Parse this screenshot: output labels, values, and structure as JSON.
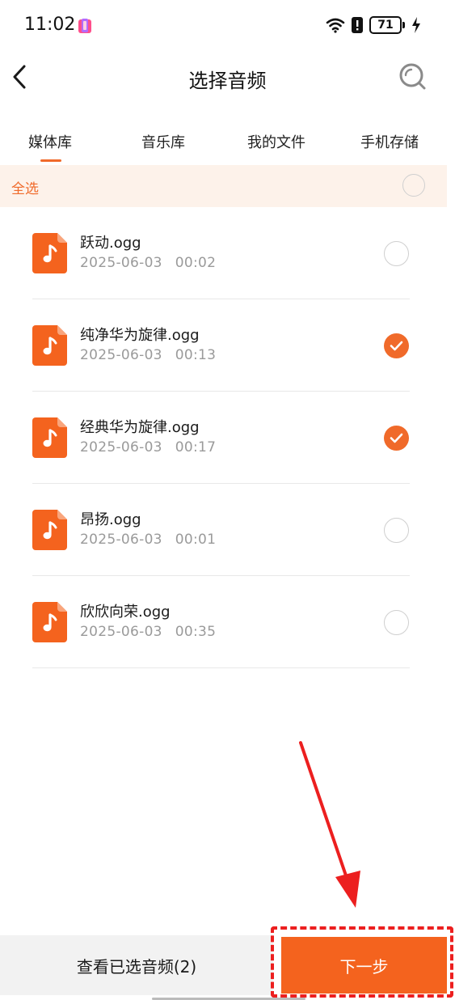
{
  "status_bar": {
    "time": "11:02",
    "battery": "71",
    "icons": [
      "app-badge-icon",
      "wifi-icon",
      "alert-icon",
      "battery-icon",
      "charging-icon"
    ]
  },
  "header": {
    "title": "选择音频",
    "back_icon": "chevron-left-icon",
    "search_icon": "search-icon"
  },
  "tabs": [
    {
      "label": "媒体库",
      "active": true
    },
    {
      "label": "音乐库",
      "active": false
    },
    {
      "label": "我的文件",
      "active": false
    },
    {
      "label": "手机存储",
      "active": false
    }
  ],
  "select_all": {
    "label": "全选",
    "checked": false
  },
  "files": [
    {
      "name": "跃动.ogg",
      "date": "2025-06-03",
      "duration": "00:02",
      "selected": false
    },
    {
      "name": "纯净华为旋律.ogg",
      "date": "2025-06-03",
      "duration": "00:13",
      "selected": true
    },
    {
      "name": "经典华为旋律.ogg",
      "date": "2025-06-03",
      "duration": "00:17",
      "selected": true
    },
    {
      "name": "昂扬.ogg",
      "date": "2025-06-03",
      "duration": "00:01",
      "selected": false
    },
    {
      "name": "欣欣向荣.ogg",
      "date": "2025-06-03",
      "duration": "00:35",
      "selected": false
    }
  ],
  "bottom_bar": {
    "view_selected_label": "查看已选音频(2)",
    "next_label": "下一步"
  },
  "colors": {
    "accent": "#f06a2a",
    "next_button": "#f4631e",
    "select_all_bg": "#fdf2ea",
    "annotation": "#ec1f1f"
  }
}
